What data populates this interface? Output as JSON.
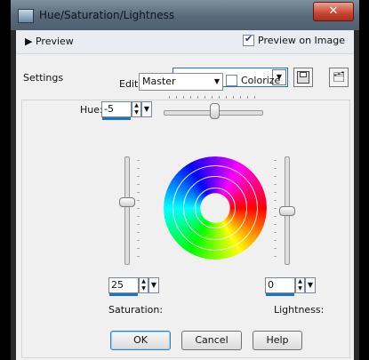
{
  "window": {
    "title": "Hue/Saturation/Lightness",
    "close_label": "✕"
  },
  "preview": {
    "toggle_label": "Preview",
    "preview_on_image_label": "Preview on Image",
    "preview_on_image_checked": true
  },
  "settings": {
    "label": "Settings",
    "value": ""
  },
  "edit": {
    "label": "Edit:",
    "value": "Master",
    "colorize_label": "Colorize",
    "colorize_checked": false
  },
  "hue": {
    "label": "Hue:",
    "value": "-5"
  },
  "saturation": {
    "label": "Saturation:",
    "value": "25"
  },
  "lightness": {
    "label": "Lightness:",
    "value": "0"
  },
  "buttons": {
    "ok": "OK",
    "cancel": "Cancel",
    "help": "Help"
  },
  "colors": {
    "accent": "#1e73c6",
    "panel": "#f0f0f0",
    "titlebar": "#59697a"
  }
}
